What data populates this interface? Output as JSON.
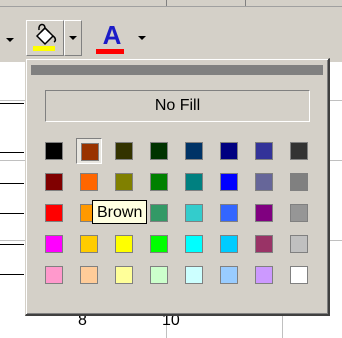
{
  "toolbar": {
    "fill_color_icon": "paint-bucket-icon",
    "fill_color_bar": "#ffff00",
    "font_color_letter": "A",
    "font_color_bar": "#ff0000"
  },
  "palette": {
    "no_fill_label": "No Fill",
    "tooltip": "Brown",
    "selected_color": "#993300",
    "rows": [
      [
        "#000000",
        "#993300",
        "#333300",
        "#003300",
        "#003366",
        "#000080",
        "#333399",
        "#333333"
      ],
      [
        "#800000",
        "#ff6600",
        "#808000",
        "#008000",
        "#008080",
        "#0000ff",
        "#666699",
        "#808080"
      ],
      [
        "#ff0000",
        "#ff9900",
        "#99cc00",
        "#339966",
        "#33cccc",
        "#3366ff",
        "#800080",
        "#969696"
      ],
      [
        "#ff00ff",
        "#ffcc00",
        "#ffff00",
        "#00ff00",
        "#00ffff",
        "#00ccff",
        "#993366",
        "#c0c0c0"
      ],
      [
        "#ff99cc",
        "#ffcc99",
        "#ffff99",
        "#ccffcc",
        "#ccffff",
        "#99ccff",
        "#cc99ff",
        "#ffffff"
      ]
    ]
  },
  "sheet": {
    "col_label_1": "8",
    "col_label_2": "10"
  }
}
